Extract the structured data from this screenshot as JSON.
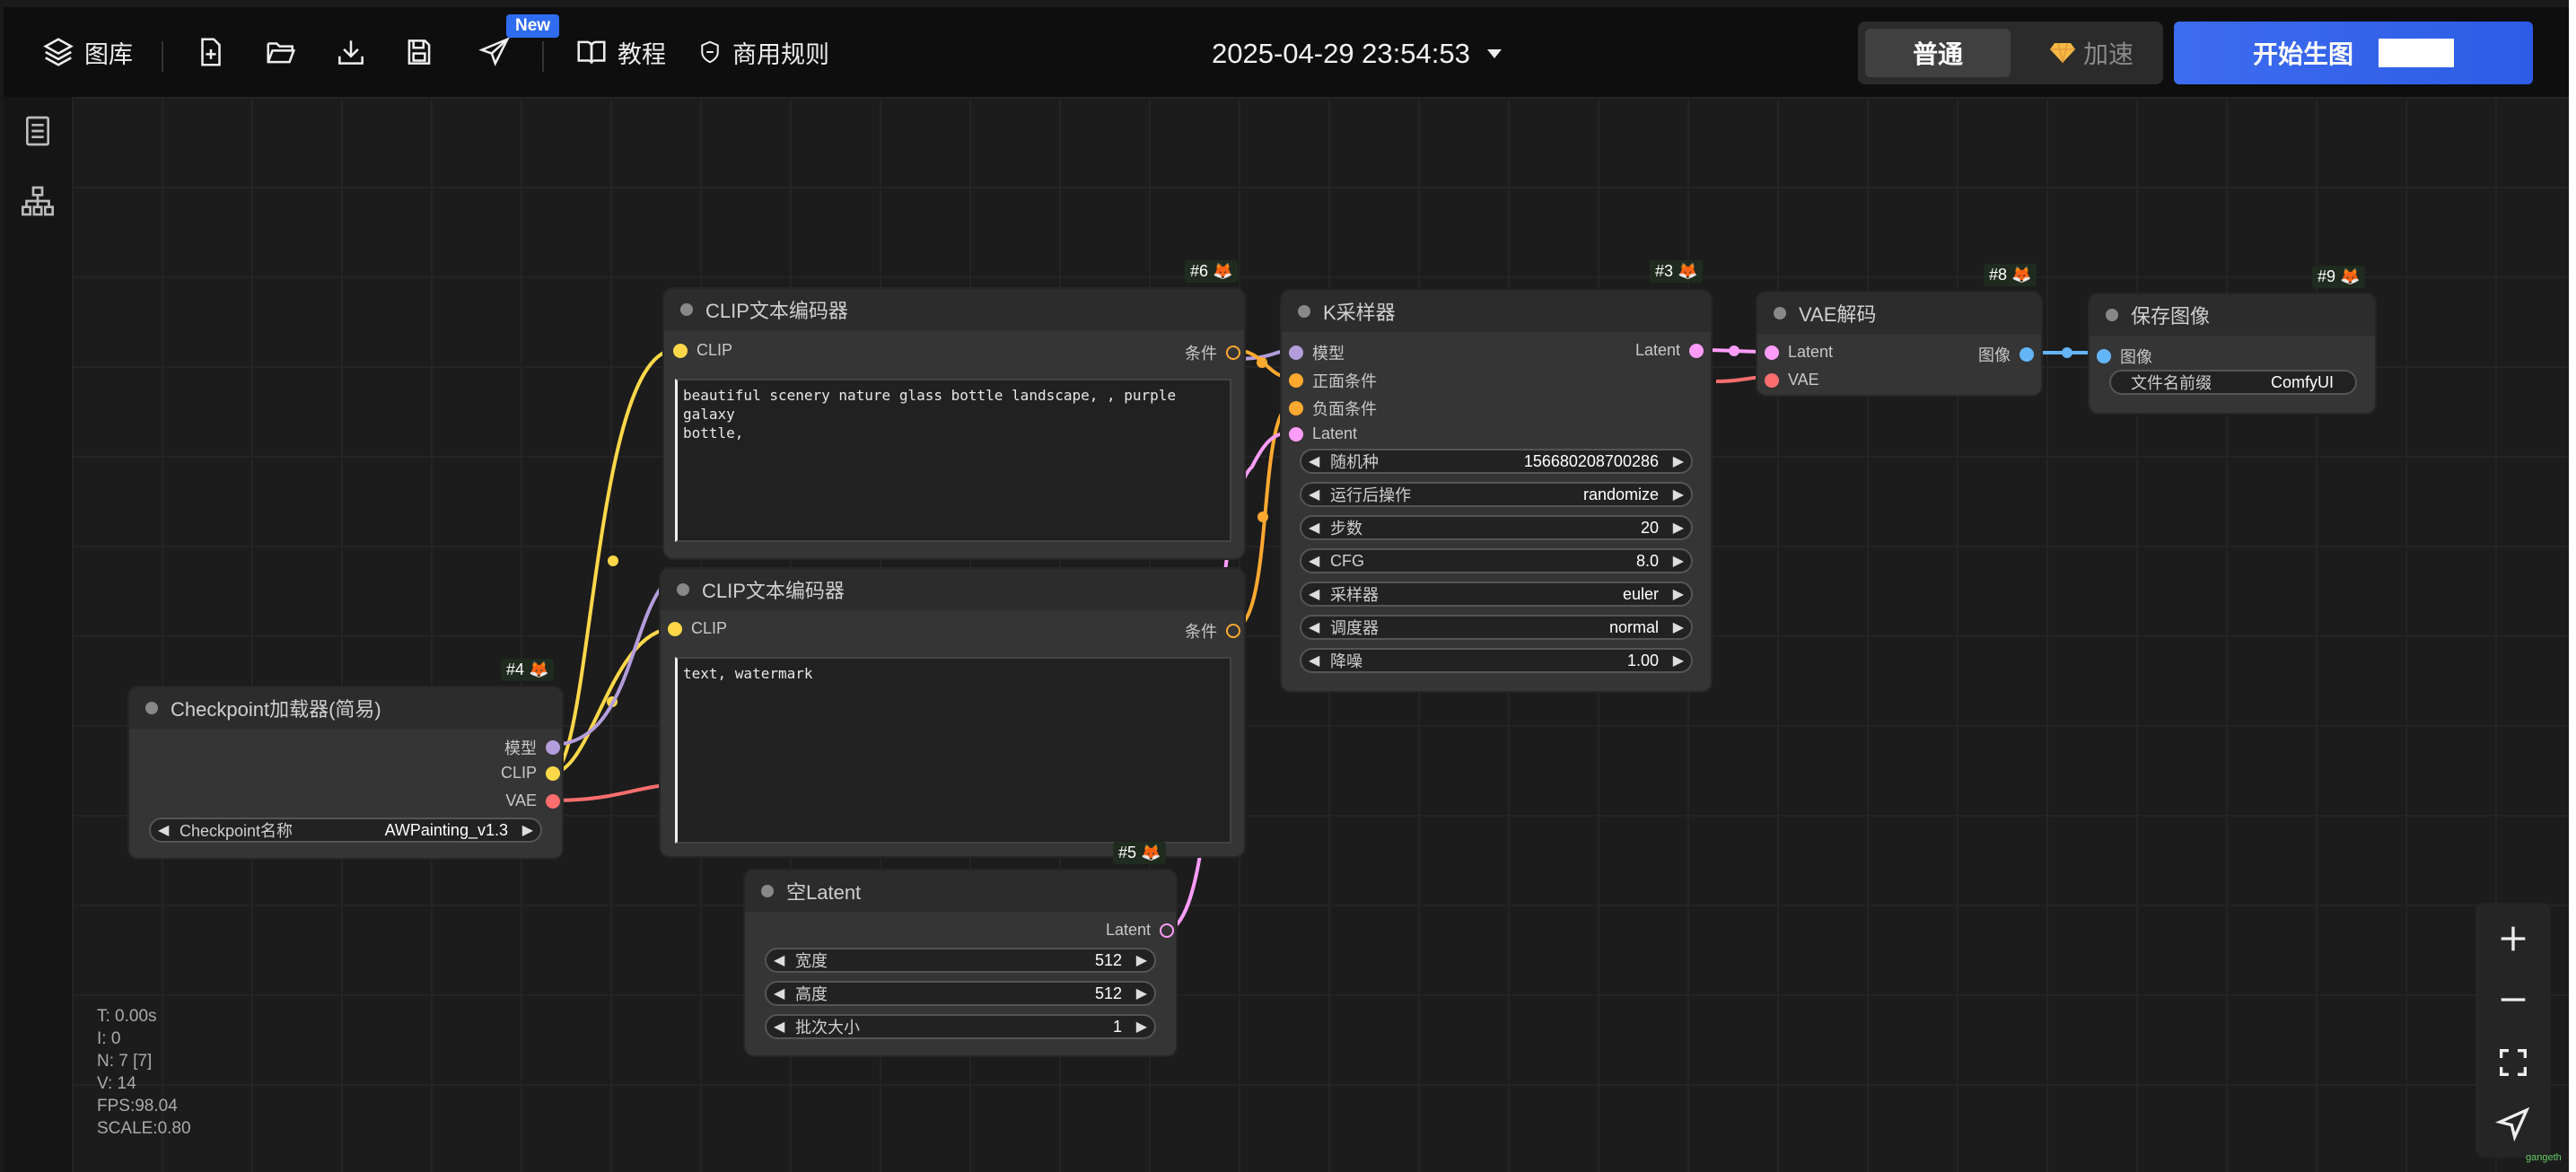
{
  "toolbar": {
    "gallery": "图库",
    "new_badge": "New",
    "tutorial": "教程",
    "rules": "商用规则",
    "datetime": "2025-04-29 23:54:53",
    "mode_normal": "普通",
    "mode_fast": "加速",
    "start": "开始生图"
  },
  "nodes": {
    "clip1": {
      "id": "#6",
      "title": "CLIP文本编码器",
      "in": "CLIP",
      "out": "条件",
      "text": "beautiful scenery nature glass bottle landscape, , purple galaxy\nbottle,"
    },
    "clip2": {
      "title": "CLIP文本编码器",
      "in": "CLIP",
      "out": "条件",
      "text": "text, watermark"
    },
    "ksampler": {
      "id": "#3",
      "title": "K采样器",
      "inputs": [
        "模型",
        "正面条件",
        "负面条件",
        "Latent"
      ],
      "out": "Latent",
      "widgets": [
        {
          "label": "随机种",
          "value": "156680208700286"
        },
        {
          "label": "运行后操作",
          "value": "randomize"
        },
        {
          "label": "步数",
          "value": "20"
        },
        {
          "label": "CFG",
          "value": "8.0"
        },
        {
          "label": "采样器",
          "value": "euler"
        },
        {
          "label": "调度器",
          "value": "normal"
        },
        {
          "label": "降噪",
          "value": "1.00"
        }
      ]
    },
    "vae": {
      "id": "#8",
      "title": "VAE解码",
      "in1": "Latent",
      "in2": "VAE",
      "out": "图像"
    },
    "save": {
      "id": "#9",
      "title": "保存图像",
      "in": "图像",
      "widget_label": "文件名前缀",
      "widget_value": "ComfyUI"
    },
    "ckpt": {
      "id": "#4",
      "title": "Checkpoint加载器(简易)",
      "outs": [
        "模型",
        "CLIP",
        "VAE"
      ],
      "widget_label": "Checkpoint名称",
      "widget_value": "AWPainting_v1.3"
    },
    "latent": {
      "id": "#5",
      "title": "空Latent",
      "out": "Latent",
      "widgets": [
        {
          "label": "宽度",
          "value": "512"
        },
        {
          "label": "高度",
          "value": "512"
        },
        {
          "label": "批次大小",
          "value": "1"
        }
      ]
    }
  },
  "stats": [
    "T: 0.00s",
    "I: 0",
    "N: 7 [7]",
    "V: 14",
    "FPS:98.04",
    "SCALE:0.80"
  ],
  "watermark": "gangeth",
  "colors": {
    "clip": "#ffd84a",
    "cond": "#ffa931",
    "model": "#b39ddb",
    "latent": "#ff9cf9",
    "vae": "#ff6e6e",
    "image": "#64b5f6"
  }
}
